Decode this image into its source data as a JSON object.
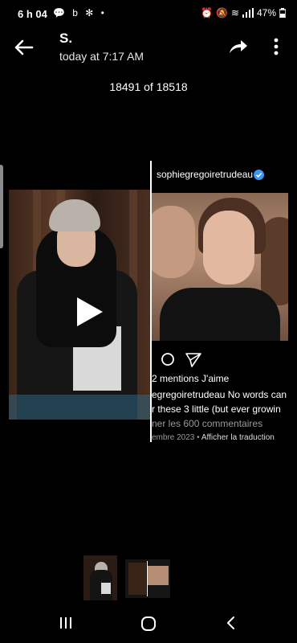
{
  "status": {
    "time": "6 h 04",
    "left_icons": "💬 b ✻ •",
    "battery": "47%"
  },
  "header": {
    "sender": "S.",
    "timestamp": "today at 7:17 AM"
  },
  "counter": "18491 of 18518",
  "instagram": {
    "username": "sophiegregoiretrudeau",
    "likes": "2 mentions J'aime",
    "caption_1": "egregoiretrudeau No words can",
    "caption_2": "r these 3 little (but ever growin",
    "comments": "ner les 600 commentaires",
    "date": "embre 2023",
    "translate": "Afficher la traduction"
  },
  "colors": {
    "background": "#000000",
    "verified": "#3b97f2",
    "muted": "#9a9a9a"
  }
}
